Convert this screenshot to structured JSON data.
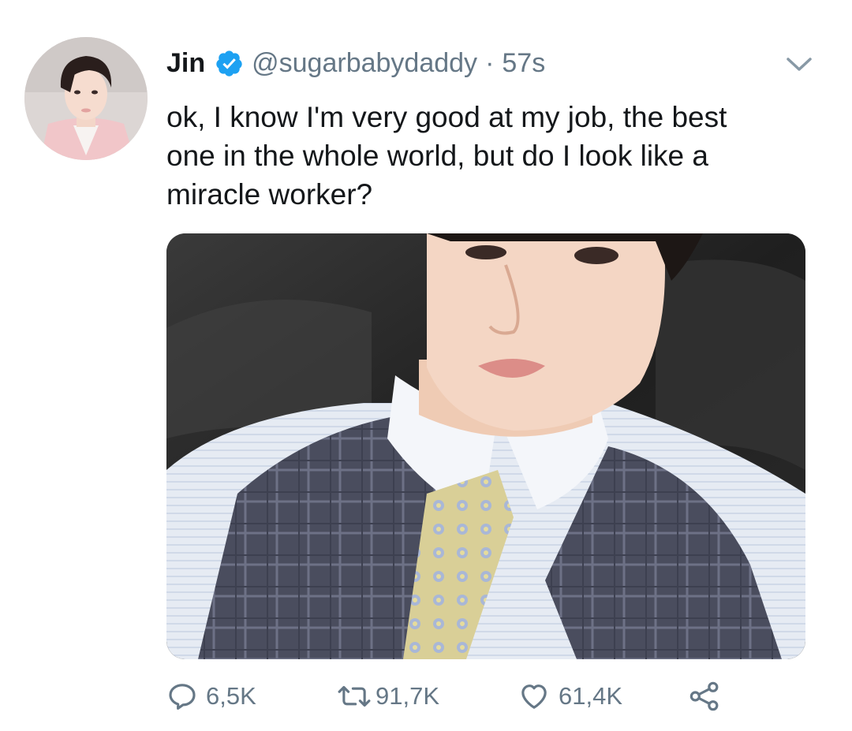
{
  "tweet": {
    "display_name": "Jin",
    "verified": true,
    "handle": "@sugarbabydaddy",
    "separator": "·",
    "time": "57s",
    "text": "ok, I know I'm very good at my job, the best\none in the whole world, but do I look like a\nmiracle worker?",
    "icons": {
      "verified": "verified-badge-icon",
      "menu": "chevron-down-icon",
      "reply": "reply-icon",
      "retweet": "retweet-icon",
      "like": "heart-icon",
      "share": "share-icon"
    },
    "actions": {
      "replies": "6,5K",
      "retweets": "91,7K",
      "likes": "61,4K"
    }
  },
  "colors": {
    "verified_blue": "#1da1f2",
    "secondary_text": "#657786",
    "primary_text": "#14171a"
  }
}
